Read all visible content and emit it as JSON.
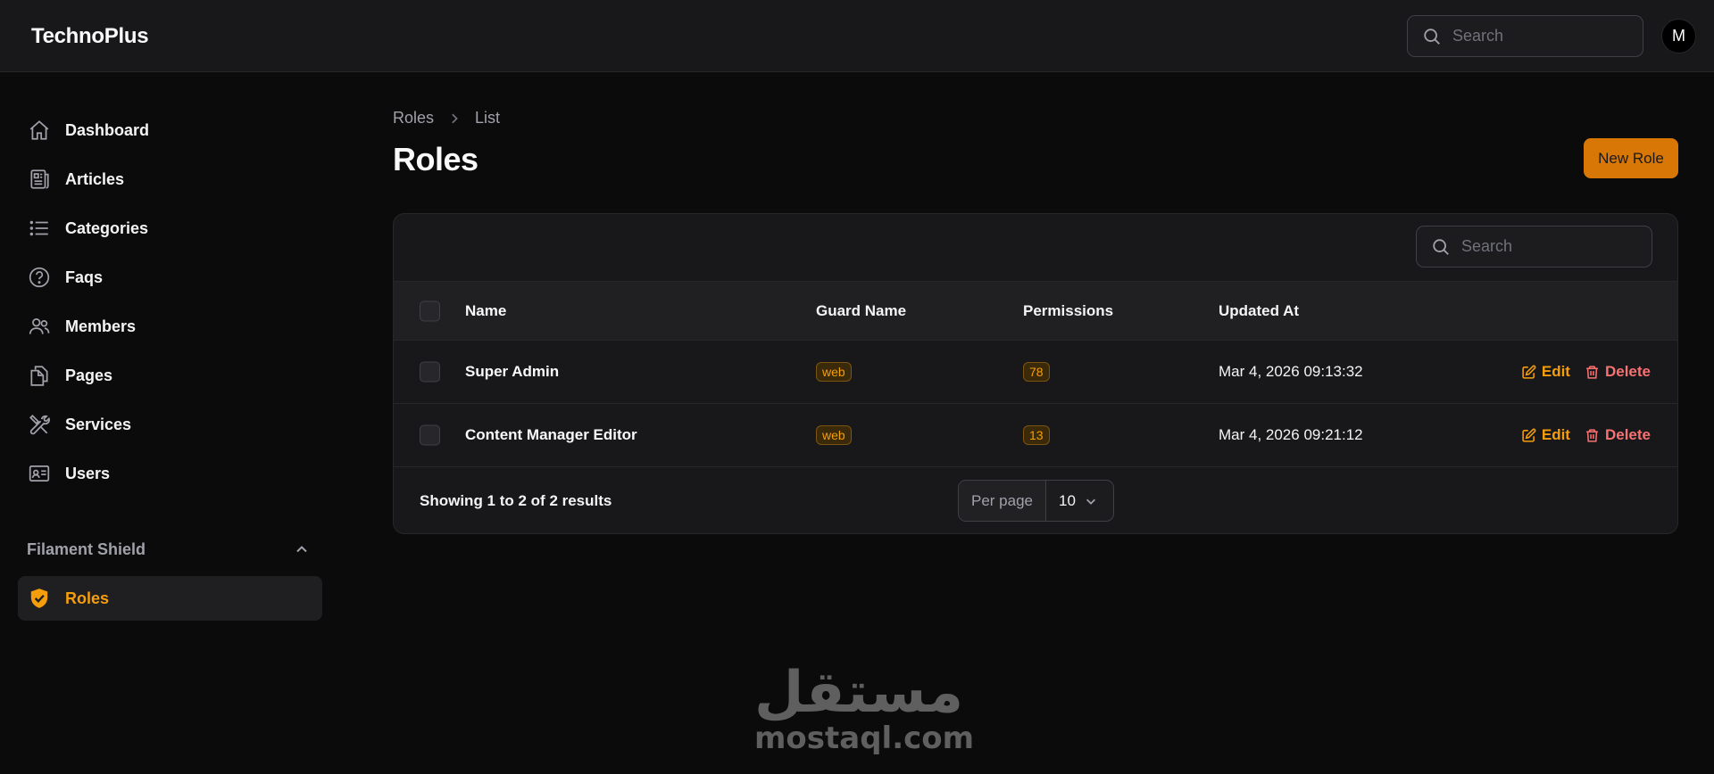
{
  "app": {
    "brand": "TechnoPlus"
  },
  "topbar": {
    "search_placeholder": "Search",
    "avatar_initial": "M"
  },
  "sidebar": {
    "items": [
      {
        "label": "Dashboard",
        "icon": "home-icon"
      },
      {
        "label": "Articles",
        "icon": "newspaper-icon"
      },
      {
        "label": "Categories",
        "icon": "list-icon"
      },
      {
        "label": "Faqs",
        "icon": "question-circle-icon"
      },
      {
        "label": "Members",
        "icon": "users-icon"
      },
      {
        "label": "Pages",
        "icon": "documents-icon"
      },
      {
        "label": "Services",
        "icon": "tools-icon"
      },
      {
        "label": "Users",
        "icon": "id-card-icon"
      }
    ],
    "group": {
      "label": "Filament Shield",
      "icon": "chevron-up-icon"
    },
    "active_item": {
      "label": "Roles",
      "icon": "shield-check-icon"
    }
  },
  "breadcrumb": {
    "root": "Roles",
    "current": "List"
  },
  "page": {
    "title": "Roles",
    "new_button": "New Role"
  },
  "table": {
    "search_placeholder": "Search",
    "columns": {
      "name": "Name",
      "guard": "Guard Name",
      "permissions": "Permissions",
      "updated": "Updated At"
    },
    "rows": [
      {
        "name": "Super Admin",
        "guard": "web",
        "permissions": "78",
        "updated": "Mar 4, 2026 09:13:32"
      },
      {
        "name": "Content Manager Editor",
        "guard": "web",
        "permissions": "13",
        "updated": "Mar 4, 2026 09:21:12"
      }
    ],
    "actions": {
      "edit": "Edit",
      "delete": "Delete"
    },
    "footer": {
      "summary": "Showing 1 to 2 of 2 results",
      "per_page_label": "Per page",
      "per_page_value": "10"
    }
  },
  "watermark": {
    "arabic": "مستقل",
    "latin": "mostaql.com"
  },
  "colors": {
    "accent": "#d97706",
    "accent_text": "#f59e0b",
    "danger": "#f87171",
    "background": "#0b0b0c",
    "surface": "#18181b"
  }
}
